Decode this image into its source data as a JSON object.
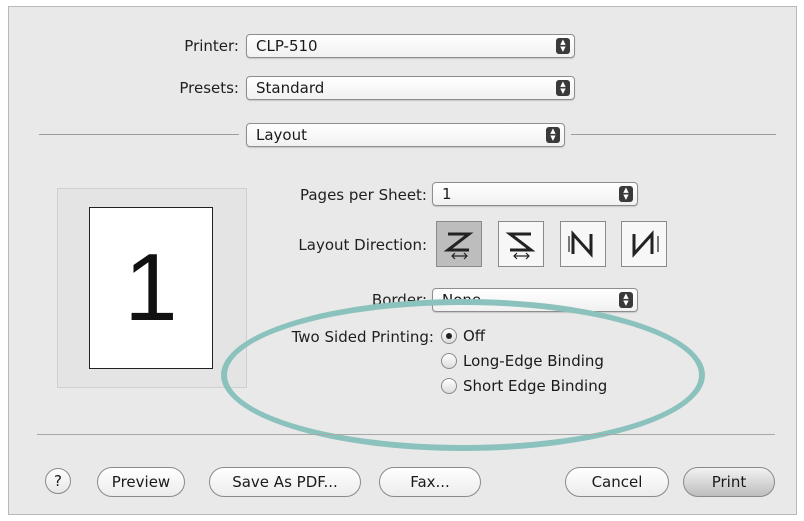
{
  "printer": {
    "label": "Printer:",
    "value": "CLP-510"
  },
  "presets": {
    "label": "Presets:",
    "value": "Standard"
  },
  "panel": {
    "value": "Layout"
  },
  "preview": {
    "page_number": "1"
  },
  "layout": {
    "pages_per_sheet": {
      "label": "Pages per Sheet:",
      "value": "1"
    },
    "layout_direction": {
      "label": "Layout Direction:",
      "options": [
        "left-to-right-top-to-bottom",
        "right-to-left-top-to-bottom",
        "top-to-bottom-left-to-right",
        "top-to-bottom-right-to-left"
      ],
      "selected_index": 0
    },
    "border": {
      "label": "Border:",
      "value": "None"
    },
    "two_sided": {
      "label": "Two Sided Printing:",
      "options": [
        {
          "label": "Off",
          "selected": true
        },
        {
          "label": "Long-Edge Binding",
          "selected": false
        },
        {
          "label": "Short Edge Binding",
          "selected": false
        }
      ]
    }
  },
  "buttons": {
    "help": "?",
    "preview": "Preview",
    "save_pdf": "Save As PDF...",
    "fax": "Fax...",
    "cancel": "Cancel",
    "print": "Print"
  },
  "colors": {
    "highlight_ellipse": "#8cc2bd",
    "dialog_bg": "#e9e9e9"
  }
}
